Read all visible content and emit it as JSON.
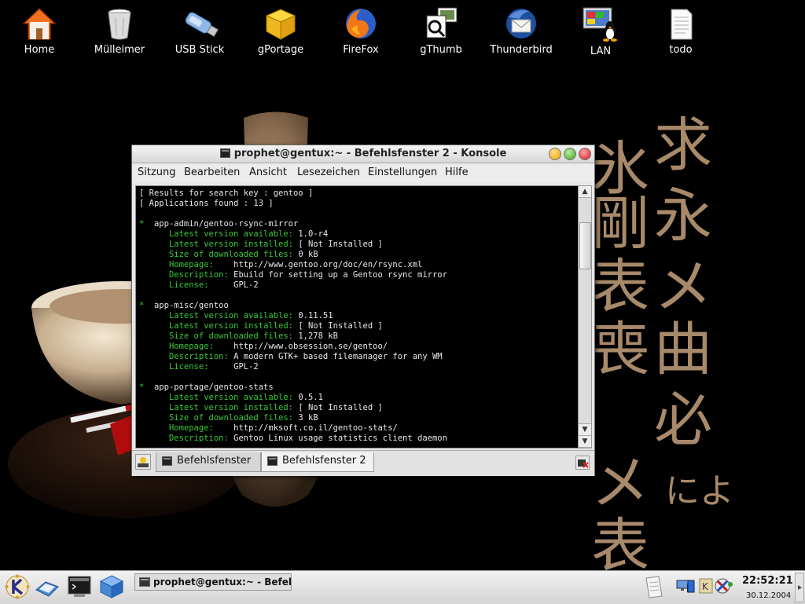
{
  "desktop_icons": [
    {
      "label": "Home",
      "icon": "home-icon"
    },
    {
      "label": "Mülleimer",
      "icon": "trash-icon"
    },
    {
      "label": "USB Stick",
      "icon": "usb-stick-icon"
    },
    {
      "label": "gPortage",
      "icon": "gportage-box-icon"
    },
    {
      "label": "FireFox",
      "icon": "firefox-icon"
    },
    {
      "label": "gThumb",
      "icon": "gthumb-icon"
    },
    {
      "label": "Thunderbird",
      "icon": "thunderbird-icon"
    },
    {
      "label": "LAN",
      "icon": "lan-monitor-icon"
    },
    {
      "label": "todo",
      "icon": "text-file-icon"
    }
  ],
  "window": {
    "title": "prophet@gentux:~ - Befehlsfenster 2 - Konsole",
    "menu": [
      "Sitzung",
      "Bearbeiten",
      "Ansicht",
      "Lesezeichen",
      "Einstellungen",
      "Hilfe"
    ],
    "tabs": [
      "Befehlsfenster",
      "Befehlsfenster 2"
    ],
    "active_tab": "Befehlsfenster 2",
    "colors": {
      "green": "#38c838",
      "white": "#e8e8e8",
      "background": "#000000"
    }
  },
  "terminal": {
    "search_key_prefix": "[ Results for search key : ",
    "search_key": "gentoo",
    "search_key_suffix": " ]",
    "found_prefix": "[ Applications found : ",
    "found_count": "13",
    "found_suffix": " ]",
    "bullet": "*",
    "field_labels": {
      "latest_available": "Latest version available:",
      "latest_installed": "Latest version installed:",
      "size": "Size of downloaded files:",
      "homepage": "Homepage:",
      "description": "Description:",
      "license": "License:"
    },
    "packages": [
      {
        "name": "app-admin/gentoo-rsync-mirror",
        "latest_available": "1.0-r4",
        "latest_installed": "[ Not Installed ]",
        "size": "0 kB",
        "homepage": "http://www.gentoo.org/doc/en/rsync.xml",
        "description": "Ebuild for setting up a Gentoo rsync mirror",
        "license": "GPL-2"
      },
      {
        "name": "app-misc/gentoo",
        "latest_available": "0.11.51",
        "latest_installed": "[ Not Installed ]",
        "size": "1,278 kB",
        "homepage": "http://www.obsession.se/gentoo/",
        "description": "A modern GTK+ based filemanager for any WM",
        "license": "GPL-2"
      },
      {
        "name": "app-portage/gentoo-stats",
        "latest_available": "0.5.1",
        "latest_installed": "[ Not Installed ]",
        "size": "3 kB",
        "homepage": "http://mksoft.co.il/gentoo-stats/",
        "description": "Gentoo Linux usage statistics client daemon"
      }
    ]
  },
  "taskbar": {
    "task_label": "prophet@gentux:~ - Befeh",
    "clock_time": "22:52:21",
    "clock_date": "30.12.2004"
  }
}
